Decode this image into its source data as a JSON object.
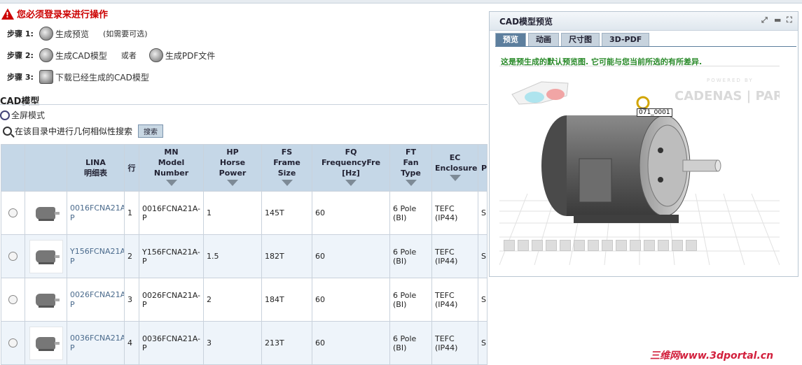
{
  "warning": {
    "text": "您必须登录来进行操作"
  },
  "steps": {
    "s1": {
      "label": "步骤 1:",
      "link": "生成预览",
      "note": "(如需要可选)"
    },
    "s2": {
      "label": "步骤 2:",
      "link_cad": "生成CAD模型",
      "or": "或者",
      "link_pdf": "生成PDF文件"
    },
    "s3": {
      "label": "步骤 3:",
      "link": "下载已经生成的CAD模型"
    }
  },
  "cad": {
    "title": "CAD模型",
    "fullscreen": "全屏模式",
    "search_text": "在该目录中进行几何相似性搜索",
    "search_button": "搜索"
  },
  "table": {
    "headers": {
      "lina_top": "LINA",
      "lina_sub": "明细表",
      "row": "行",
      "mn_top": "MN",
      "mn_sub": "Model Number",
      "hp_top": "HP",
      "hp_sub": "Horse Power",
      "fs_top": "FS",
      "fs_sub": "Frame Size",
      "fq_top": "FQ",
      "fq_sub": "FrequencyFre [Hz]",
      "ft_top": "FT",
      "ft_sub": "Fan Type",
      "ec_top": "EC",
      "ec_sub": "Enclosure",
      "p_top": "P"
    },
    "rows": [
      {
        "lina": "0016FCNA21A-P",
        "row": "1",
        "mn": "0016FCNA21A-P",
        "hp": "1",
        "fs": "145T",
        "fq": "60",
        "ft": "6 Pole (BI)",
        "ec": "TEFC (IP44)",
        "p": "S"
      },
      {
        "lina": "Y156FCNA21A-P",
        "row": "2",
        "mn": "Y156FCNA21A-P",
        "hp": "1.5",
        "fs": "182T",
        "fq": "60",
        "ft": "6 Pole (BI)",
        "ec": "TEFC (IP44)",
        "p": "S"
      },
      {
        "lina": "0026FCNA21A-P",
        "row": "3",
        "mn": "0026FCNA21A-P",
        "hp": "2",
        "fs": "184T",
        "fq": "60",
        "ft": "6 Pole (BI)",
        "ec": "TEFC (IP44)",
        "p": "S"
      },
      {
        "lina": "0036FCNA21A-P",
        "row": "4",
        "mn": "0036FCNA21A-P",
        "hp": "3",
        "fs": "213T",
        "fq": "60",
        "ft": "6 Pole (BI)",
        "ec": "TEFC (IP44)",
        "p": "S"
      }
    ]
  },
  "preview": {
    "title": "CAD模型预览",
    "tabs": [
      "预览",
      "动画",
      "尺寸图",
      "3D-PDF"
    ],
    "message": "这是预生成的默认预览图. 它可能与您当前所选的有所差异.",
    "powered_small": "POWERED BY",
    "powered_big": "CADENAS | PARTsolutions",
    "part_label": "071_0001"
  },
  "watermark": "三维网www.3dportal.cn"
}
